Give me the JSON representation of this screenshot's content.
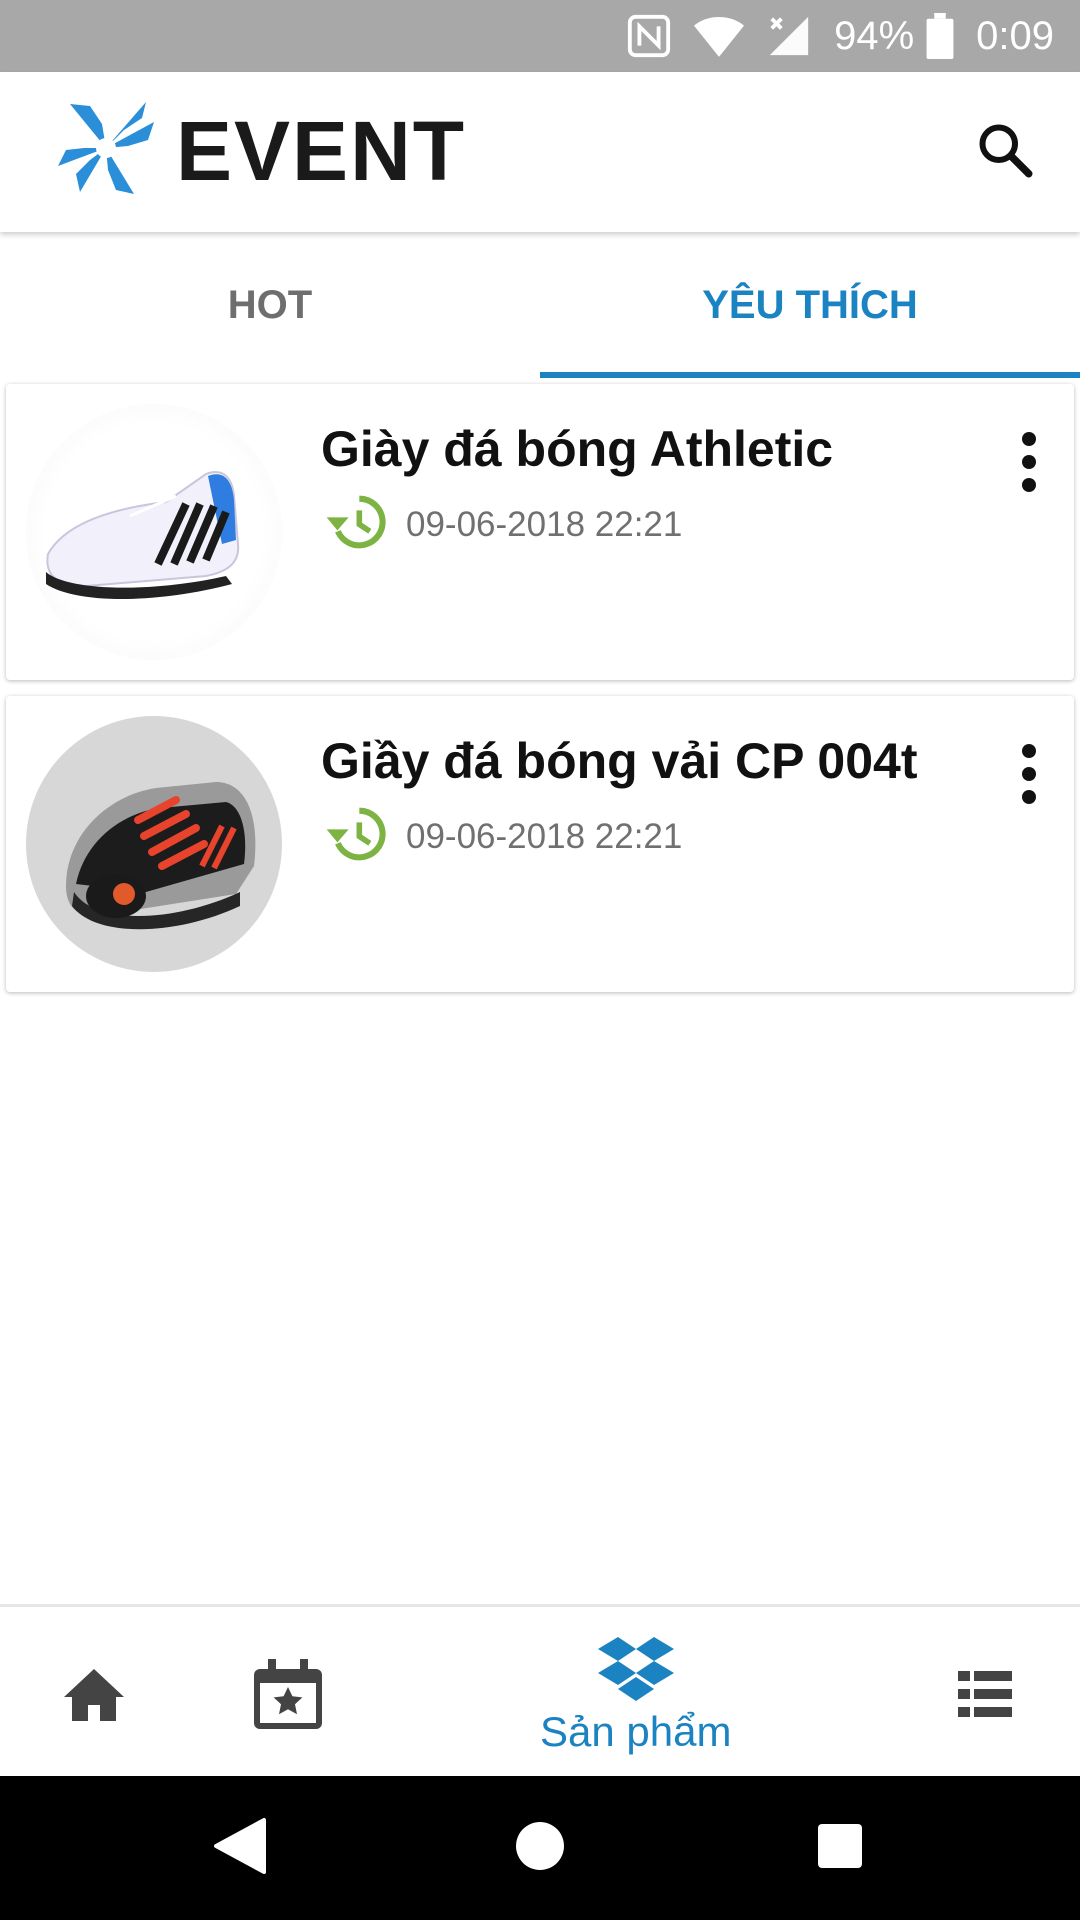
{
  "status_bar": {
    "battery_text": "94%",
    "time": "0:09",
    "icons": [
      "nfc-icon",
      "wifi-icon",
      "signal-no-sim-icon",
      "battery-icon"
    ]
  },
  "app_bar": {
    "logo_text": "EVENT",
    "search_icon": "search-icon"
  },
  "tabs": [
    {
      "label": "HOT",
      "active": false
    },
    {
      "label": "YÊU THÍCH",
      "active": true
    }
  ],
  "items": [
    {
      "title": "Giày đá bóng Athletic",
      "time": "09-06-2018 22:21",
      "image": "white-black-football-shoe"
    },
    {
      "title": "Giầy đá bóng vải CP 004t",
      "time": "09-06-2018 22:21",
      "image": "black-red-football-shoes"
    }
  ],
  "bottom_nav": {
    "items": [
      {
        "icon": "home-icon",
        "label": ""
      },
      {
        "icon": "calendar-star-icon",
        "label": ""
      },
      {
        "icon": "product-box-icon",
        "label": "Sản phẩm",
        "active": true
      },
      {
        "icon": "list-icon",
        "label": ""
      }
    ]
  },
  "colors": {
    "accent": "#1b83c1",
    "history_green": "#7cb342",
    "status_bar": "#a8a8a8"
  }
}
